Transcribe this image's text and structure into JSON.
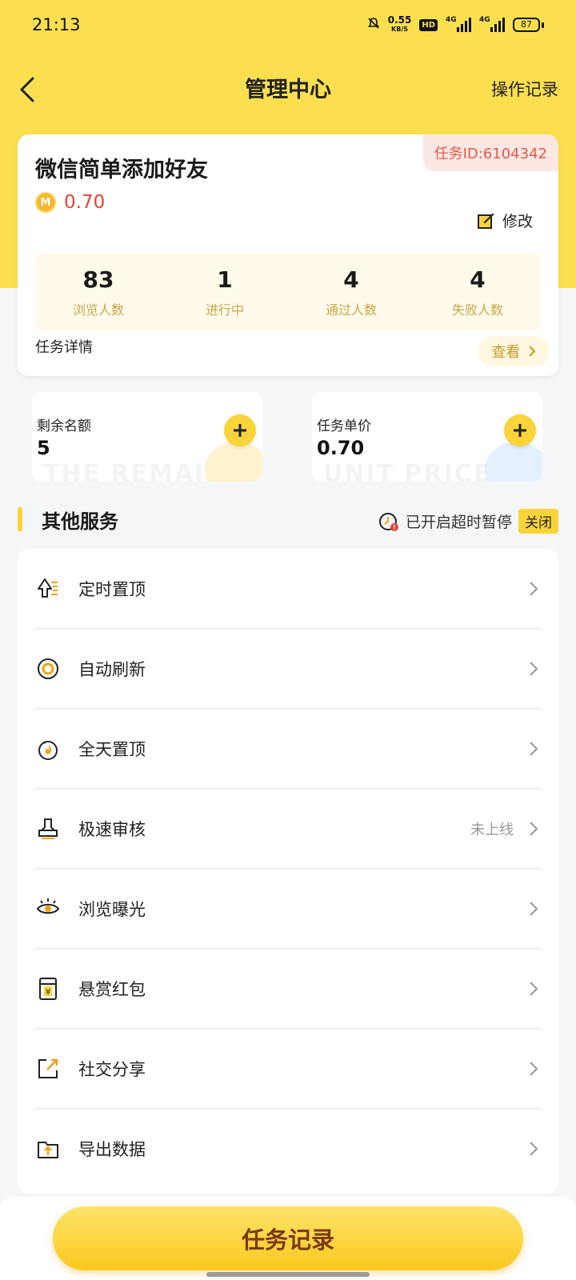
{
  "status_bar": {
    "time": "21:13",
    "net_speed_value": "0.55",
    "net_speed_unit": "KB/S",
    "hd_badge": "HD",
    "sim1_label": "4G",
    "sim2_label": "4G",
    "battery": "87"
  },
  "nav": {
    "title": "管理中心",
    "right_action": "操作记录"
  },
  "task_card": {
    "task_id": "任务ID:6104342",
    "title": "微信简单添加好友",
    "coin_symbol": "M",
    "price": "0.70",
    "modify_label": "修改",
    "stats": [
      {
        "value": "83",
        "label": "浏览人数"
      },
      {
        "value": "1",
        "label": "进行中"
      },
      {
        "value": "4",
        "label": "通过人数"
      },
      {
        "value": "4",
        "label": "失败人数"
      }
    ],
    "detail_label": "任务详情",
    "view_label": "查看"
  },
  "mini_cards": {
    "remaining": {
      "label": "剩余名额",
      "value": "5",
      "watermark": "THE REMAI"
    },
    "unit_price": {
      "label": "任务单价",
      "value": "0.70",
      "watermark": "UNIT PRICE"
    }
  },
  "services_section": {
    "title": "其他服务",
    "timeout_text": "已开启超时暂停",
    "timeout_toggle": "关闭"
  },
  "services": [
    {
      "label": "定时置顶",
      "status": "",
      "icon": "pin-top-icon"
    },
    {
      "label": "自动刷新",
      "status": "",
      "icon": "refresh-icon"
    },
    {
      "label": "全天置顶",
      "status": "",
      "icon": "flame-icon"
    },
    {
      "label": "极速审核",
      "status": "未上线",
      "icon": "stamp-icon"
    },
    {
      "label": "浏览曝光",
      "status": "",
      "icon": "eye-icon"
    },
    {
      "label": "悬赏红包",
      "status": "",
      "icon": "red-packet-icon"
    },
    {
      "label": "社交分享",
      "status": "",
      "icon": "share-icon"
    },
    {
      "label": "导出数据",
      "status": "",
      "icon": "export-folder-icon"
    }
  ],
  "bottom": {
    "record_button": "任务记录"
  },
  "colors": {
    "brand_yellow": "#fbdf4f",
    "accent_red": "#e2443b",
    "stat_label": "#c6a84a"
  }
}
